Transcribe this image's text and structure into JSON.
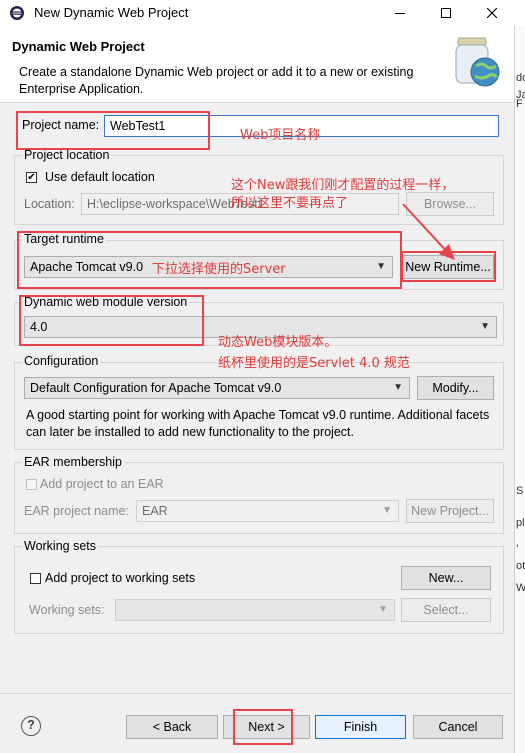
{
  "window": {
    "title": "New Dynamic Web Project"
  },
  "header": {
    "title": "Dynamic Web Project",
    "description": "Create a standalone Dynamic Web project or add it to a new or existing Enterprise Application."
  },
  "project_name": {
    "label": "Project name:",
    "value": "WebTest1"
  },
  "project_location": {
    "legend": "Project location",
    "use_default_label": "Use default location",
    "use_default_checked": true,
    "location_label": "Location:",
    "location_value": "H:\\eclipse-workspace\\WebTest1",
    "browse_label": "Browse..."
  },
  "target_runtime": {
    "legend": "Target runtime",
    "selected": "Apache Tomcat v9.0",
    "new_runtime_label": "New Runtime..."
  },
  "module_version": {
    "legend": "Dynamic web module version",
    "selected": "4.0"
  },
  "configuration": {
    "legend": "Configuration",
    "selected": "Default Configuration for Apache Tomcat v9.0",
    "modify_label": "Modify...",
    "description": "A good starting point for working with Apache Tomcat v9.0 runtime. Additional facets can later be installed to add new functionality to the project."
  },
  "ear": {
    "legend": "EAR membership",
    "add_label": "Add project to an EAR",
    "project_name_label": "EAR project name:",
    "project_name_value": "EAR",
    "new_project_label": "New Project..."
  },
  "working_sets": {
    "legend": "Working sets",
    "add_label": "Add project to working sets",
    "new_label": "New...",
    "sets_label": "Working sets:",
    "select_label": "Select..."
  },
  "footer": {
    "help_icon_text": "?",
    "back_label": "< Back",
    "next_label": "Next >",
    "finish_label": "Finish",
    "cancel_label": "Cancel"
  },
  "annotations": {
    "project_name_note": "Web项目名称",
    "new_note_line1": "这个New跟我们刚才配置的过程一样，",
    "new_note_line2": "所以这里不要再点了",
    "runtime_note": "下拉选择使用的Server",
    "version_note_line1": "动态Web模块版本。",
    "version_note_line2": "纸杯里使用的是Servlet 4.0 规范"
  },
  "right_strip": {
    "chars": [
      "do",
      "Ja",
      "F",
      "S",
      "ple",
      ",",
      "oti",
      "Wa"
    ]
  },
  "colors": {
    "annotation_red": "#e8424a",
    "focus_blue": "#3b77c7",
    "default_button_blue": "#0078d7"
  }
}
